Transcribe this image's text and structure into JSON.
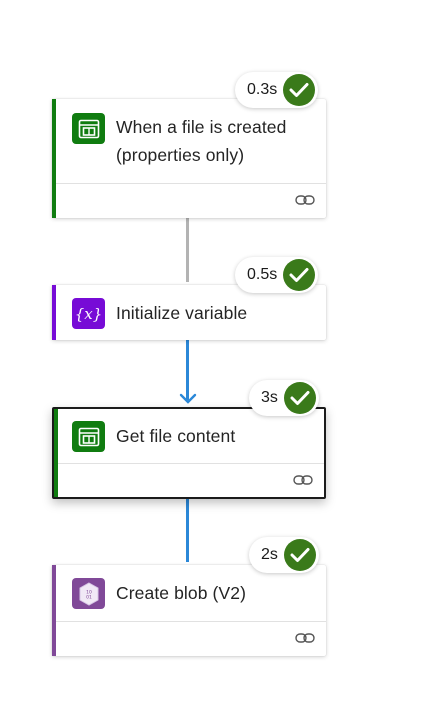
{
  "flow": {
    "steps": [
      {
        "title_line1": "When a file is created",
        "title_line2": "(properties only)",
        "duration": "0.3s",
        "status": "succeeded",
        "icon": "sharepoint-icon",
        "accent_color": "#107c10"
      },
      {
        "title_line1": "Initialize variable",
        "duration": "0.5s",
        "status": "succeeded",
        "icon": "variable-icon",
        "accent_color": "#770bd6"
      },
      {
        "title_line1": "Get file content",
        "duration": "3s",
        "status": "succeeded",
        "icon": "sharepoint-icon",
        "accent_color": "#107c10",
        "selected": true
      },
      {
        "title_line1": "Create blob (V2)",
        "duration": "2s",
        "status": "succeeded",
        "icon": "blob-storage-icon",
        "accent_color": "#804998"
      }
    ],
    "colors": {
      "success": "#3a7a1a",
      "connector_default": "#b3b3b3",
      "connector_active": "#2b88d8"
    }
  }
}
